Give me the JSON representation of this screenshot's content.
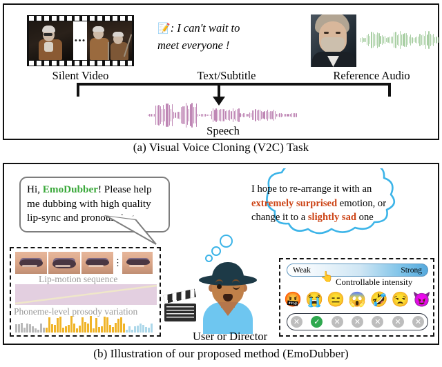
{
  "figure": {
    "panel_a_caption": "(a) Visual Voice Cloning (V2C) Task",
    "panel_b_caption": "(b) Illustration of our proposed method (EmoDubber)"
  },
  "panel_a": {
    "inputs": [
      {
        "label": "Silent Video",
        "icon": "film-strip-icon",
        "ellipsis": "•••"
      },
      {
        "label": "Text/Subtitle",
        "icon": "memo-icon",
        "emoji": "📝",
        "text_line1": ": I can't wait to",
        "text_line2": "meet everyone !"
      },
      {
        "label": "Reference Audio",
        "icon": "portrait-icon",
        "waveform_color": "#a9cfa4"
      }
    ],
    "output": {
      "label": "Speech",
      "waveform_color": "#bf87b5"
    }
  },
  "panel_b": {
    "speech_bubble": {
      "prefix": "Hi, ",
      "brand": "EmoDubber",
      "suffix": "! Please help me dubbing with high quality lip-sync and pronouncing.",
      "brand_color": "#3aa83a"
    },
    "thought_bubble": {
      "line1_a": "I hope to re-arrange it with an",
      "emph1": "extremely surprised",
      "line2_b": " emotion, or",
      "line3_a": "change it to a ",
      "emph2": "slightly sad",
      "line3_b": " one",
      "emph_color": "#cc4416",
      "outline_color": "#3cb4e8"
    },
    "left_box": {
      "lip_caption": "Lip-motion sequence",
      "prosody_caption": "Phoneme-level prosody variation",
      "lip_frames": 4,
      "vertical_ellipsis": "⋮"
    },
    "person": {
      "label": "User or Director",
      "icon": "clapperboard-icon"
    },
    "right_box": {
      "slider": {
        "left_label": "Weak",
        "right_label": "Strong",
        "cursor": "👆"
      },
      "intensity_caption": "Controllable intensity",
      "emojis": [
        {
          "name": "angry-emoji",
          "glyph": "🤬"
        },
        {
          "name": "crying-emoji",
          "glyph": "😭"
        },
        {
          "name": "neutral-emoji",
          "glyph": "😑"
        },
        {
          "name": "screaming-emoji",
          "glyph": "😱"
        },
        {
          "name": "rolling-laugh-emoji",
          "glyph": "🤣"
        },
        {
          "name": "unamused-emoji",
          "glyph": "😒"
        },
        {
          "name": "devil-emoji",
          "glyph": "😈"
        }
      ],
      "marks": [
        {
          "state": "off",
          "glyph": "✕"
        },
        {
          "state": "on",
          "glyph": "✓"
        },
        {
          "state": "off",
          "glyph": "✕"
        },
        {
          "state": "off",
          "glyph": "✕"
        },
        {
          "state": "off",
          "glyph": "✕"
        },
        {
          "state": "off",
          "glyph": "✕"
        },
        {
          "state": "off",
          "glyph": "✕"
        }
      ]
    }
  }
}
